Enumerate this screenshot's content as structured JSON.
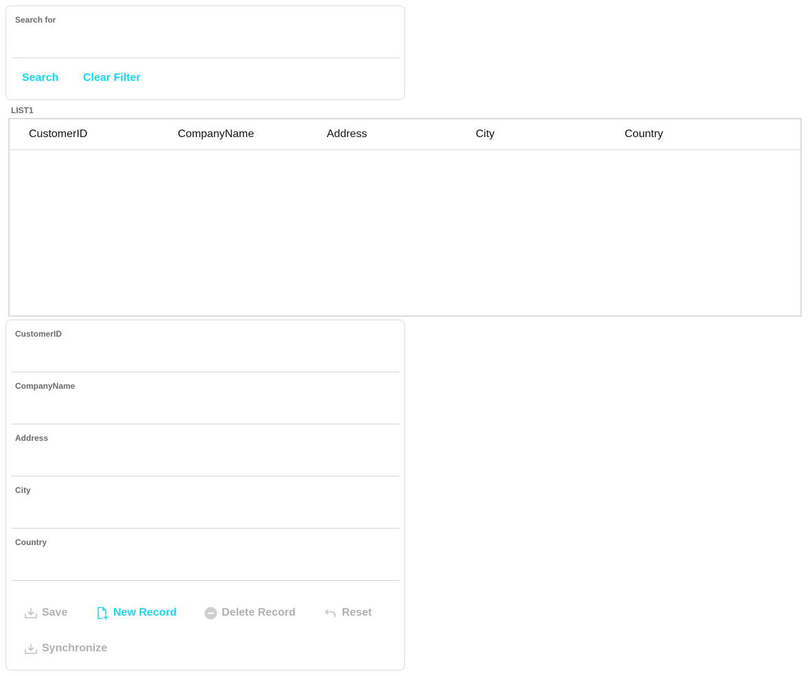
{
  "search": {
    "label": "Search for",
    "value": "",
    "search_button": "Search",
    "clear_button": "Clear Filter"
  },
  "list": {
    "title": "LIST1",
    "columns": [
      "CustomerID",
      "CompanyName",
      "Address",
      "City",
      "Country"
    ],
    "rows": []
  },
  "form": {
    "fields": [
      {
        "label": "CustomerID",
        "value": ""
      },
      {
        "label": "CompanyName",
        "value": ""
      },
      {
        "label": "Address",
        "value": ""
      },
      {
        "label": "City",
        "value": ""
      },
      {
        "label": "Country",
        "value": ""
      }
    ],
    "actions": {
      "save": "Save",
      "new_record": "New Record",
      "delete_record": "Delete Record",
      "reset": "Reset",
      "synchronize": "Synchronize"
    }
  },
  "colors": {
    "accent": "#1ad6f0",
    "disabled": "#b0b0b0",
    "label": "#6b6b6b",
    "border": "#dcdcdc"
  },
  "icons": {
    "save": "download-tray-icon",
    "new_record": "new-document-icon",
    "delete_record": "minus-circle-icon",
    "reset": "undo-arrow-icon",
    "synchronize": "download-tray-icon"
  }
}
